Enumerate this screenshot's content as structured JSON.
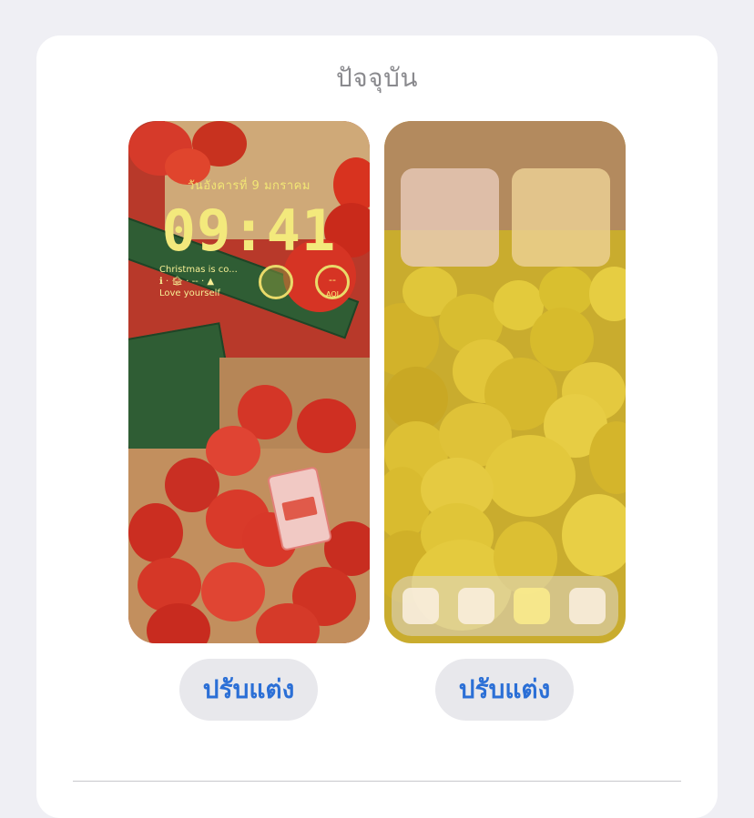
{
  "section": {
    "title": "ปัจจุบัน"
  },
  "lock_screen": {
    "date": "วันอังคารที่ 9 มกราคม",
    "time": "09:41",
    "widgets": {
      "reminder_title": "Christmas is co...",
      "reminder_icons": "ℹ · 🏚 · -- · ▲",
      "reminder_note": "Love yourself",
      "gauge_value": "--",
      "gauge_label": "AQI"
    },
    "customize_label": "ปรับแต่ง"
  },
  "home_screen": {
    "customize_label": "ปรับแต่ง"
  },
  "colors": {
    "accent": "#2b6fd6",
    "button_bg": "#e8e8ec",
    "page_bg": "#efeff4",
    "clock_yellow": "#f3e97c"
  }
}
